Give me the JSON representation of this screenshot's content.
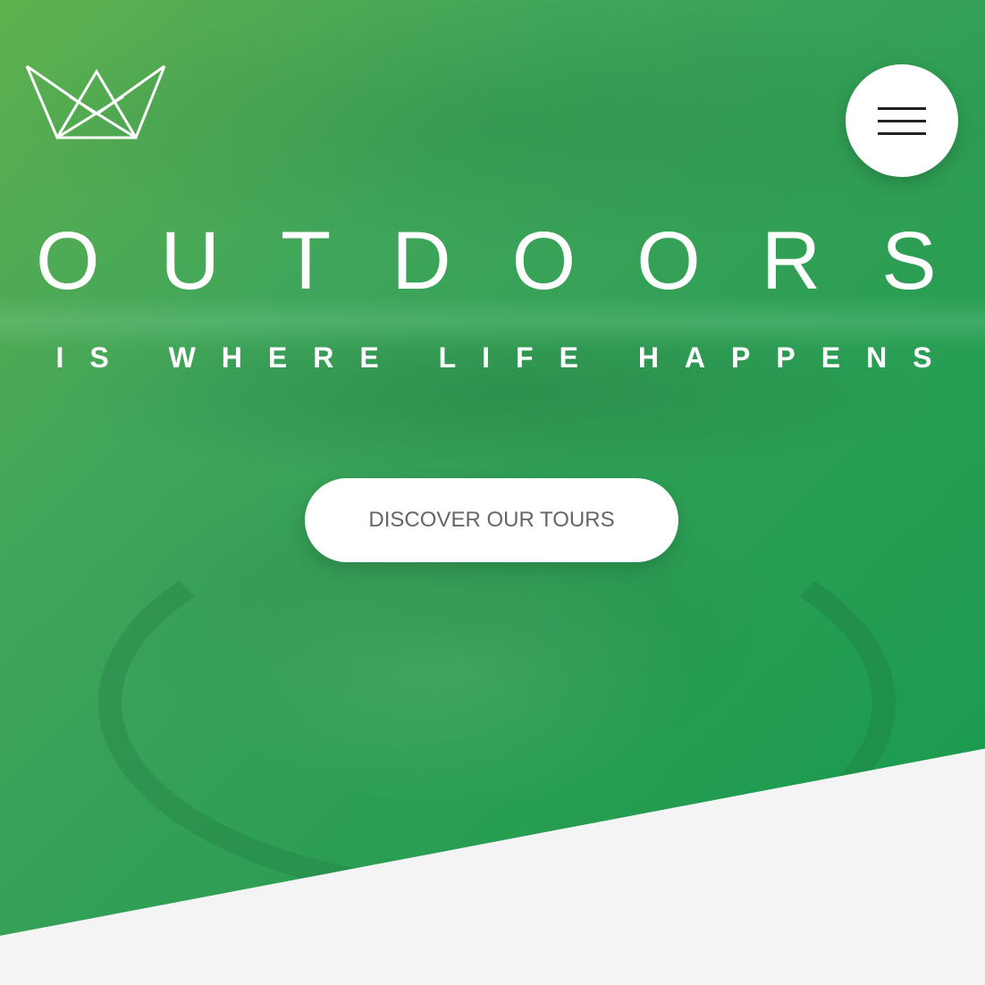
{
  "header": {
    "logo_icon": "crown-icon",
    "menu_icon": "hamburger-menu-icon"
  },
  "hero": {
    "title": "OUTDOORS",
    "subtitle": "IS WHERE LIFE HAPPENS",
    "cta_label": "DISCOVER OUR TOURS"
  },
  "colors": {
    "hero_gradient_start": "#5fb04e",
    "hero_gradient_end": "#159a4f",
    "section_background": "#f4f4f4",
    "button_background": "#ffffff",
    "button_text": "#666666"
  }
}
